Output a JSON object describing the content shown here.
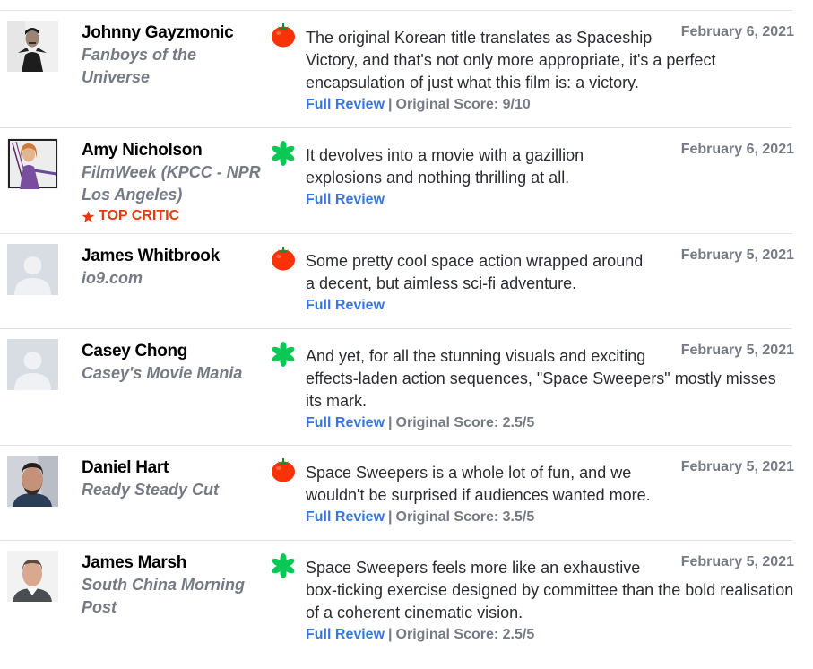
{
  "colors": {
    "accent_link": "#3976dc",
    "muted_text": "#757a84",
    "top_critic": "#e8380d",
    "fresh_tomato": "#f93208",
    "rotten_splat": "#0ac855"
  },
  "labels": {
    "full_review": "Full Review",
    "separator": "|",
    "top_critic": "TOP CRITIC"
  },
  "reviews": [
    {
      "critic": "Johnny Gayzmonic",
      "publication": "Fanboys of the Universe",
      "avatar": "photo",
      "sentiment": "fresh",
      "sentiment_icon": "fresh-tomato-icon",
      "date": "February 6, 2021",
      "quote": "The original Korean title translates as Spaceship Victory, and that's not only more appropriate, it's a perfect encapsulation of just what this film is: a victory.",
      "original_score": "Original Score: 9/10"
    },
    {
      "critic": "Amy Nicholson",
      "publication": "FilmWeek (KPCC - NPR Los Angeles)",
      "avatar": "photo",
      "top_critic": true,
      "sentiment": "rotten",
      "sentiment_icon": "rotten-splat-icon",
      "date": "February 6, 2021",
      "quote": "It devolves into a movie with a gazillion explosions and nothing thrilling at all.",
      "original_score": ""
    },
    {
      "critic": "James Whitbrook",
      "publication": "io9.com",
      "avatar": "placeholder",
      "sentiment": "fresh",
      "sentiment_icon": "fresh-tomato-icon",
      "date": "February 5, 2021",
      "quote": "Some pretty cool space action wrapped around a decent, but aimless sci-fi adventure.",
      "original_score": ""
    },
    {
      "critic": "Casey Chong",
      "publication": "Casey's Movie Mania",
      "avatar": "placeholder",
      "sentiment": "rotten",
      "sentiment_icon": "rotten-splat-icon",
      "date": "February 5, 2021",
      "quote": "And yet, for all the stunning visuals and exciting effects-laden action sequences, \"Space Sweepers\" mostly misses its mark.",
      "original_score": "Original Score: 2.5/5"
    },
    {
      "critic": "Daniel Hart",
      "publication": "Ready Steady Cut",
      "avatar": "photo",
      "sentiment": "fresh",
      "sentiment_icon": "fresh-tomato-icon",
      "date": "February 5, 2021",
      "quote": "Space Sweepers is a whole lot of fun, and we wouldn't be surprised if audiences wanted more.",
      "original_score": "Original Score: 3.5/5"
    },
    {
      "critic": "James Marsh",
      "publication": "South China Morning Post",
      "avatar": "photo",
      "sentiment": "rotten",
      "sentiment_icon": "rotten-splat-icon",
      "date": "February 5, 2021",
      "quote": "Space Sweepers feels more like an exhaustive box-ticking exercise designed by committee than the bold realisation of a coherent cinematic vision.",
      "original_score": "Original Score: 2.5/5"
    }
  ]
}
